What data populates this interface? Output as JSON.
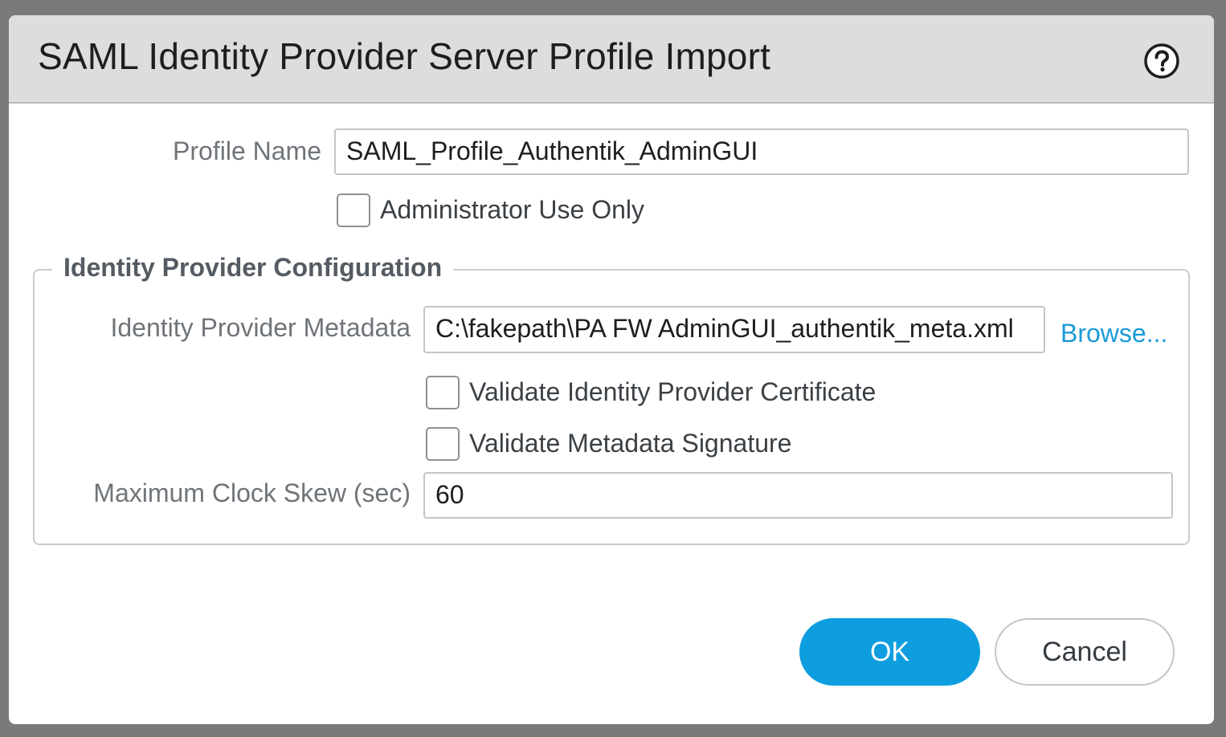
{
  "dialog": {
    "title": "SAML Identity Provider Server Profile Import",
    "help_icon": "help-circle-icon"
  },
  "profile_name": {
    "label": "Profile Name",
    "value": "SAML_Profile_Authentik_AdminGUI"
  },
  "admin_use_only": {
    "label": "Administrator Use Only",
    "checked": false
  },
  "idp_config": {
    "legend": "Identity Provider Configuration",
    "metadata": {
      "label": "Identity Provider Metadata",
      "value": "C:\\fakepath\\PA FW AdminGUI_authentik_meta.xml",
      "browse_label": "Browse..."
    },
    "validate_cert": {
      "label": "Validate Identity Provider Certificate",
      "checked": false
    },
    "validate_signature": {
      "label": "Validate Metadata Signature",
      "checked": false
    },
    "clock_skew": {
      "label": "Maximum Clock Skew (sec)",
      "value": "60"
    }
  },
  "buttons": {
    "ok": "OK",
    "cancel": "Cancel"
  },
  "colors": {
    "accent": "#0e9ee0",
    "link": "#1b9ad6",
    "header_bg": "#dcdddf"
  }
}
